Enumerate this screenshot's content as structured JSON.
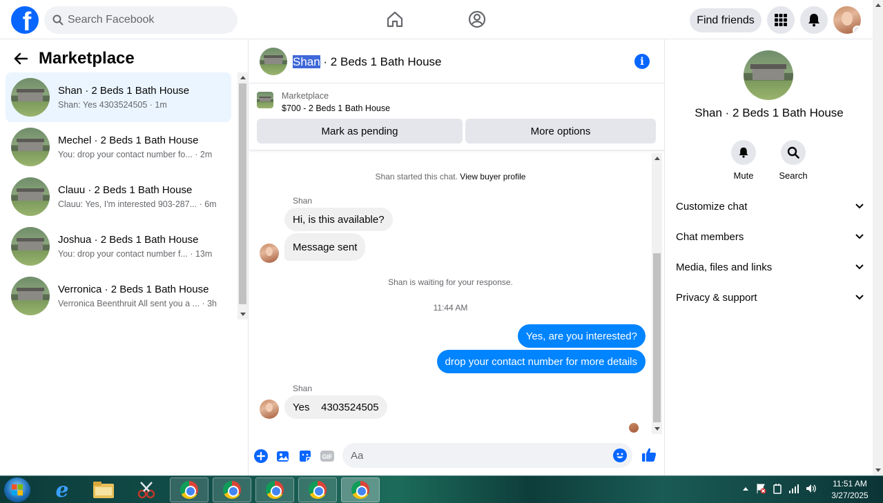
{
  "topbar": {
    "search_placeholder": "Search Facebook",
    "find_friends": "Find friends"
  },
  "left": {
    "title": "Marketplace",
    "conversations": [
      {
        "title": "Shan · 2 Beds 1 Bath House",
        "preview": "Shan: Yes 4303524505 · 1m",
        "active": true
      },
      {
        "title": "Mechel · 2 Beds 1 Bath House",
        "preview": "You: drop your contact number fo... · 2m"
      },
      {
        "title": "Clauu · 2 Beds 1 Bath House",
        "preview": "Clauu: Yes, I'm interested 903-287... · 6m"
      },
      {
        "title": "Joshua · 2 Beds 1 Bath House",
        "preview": "You: drop your contact number f... · 13m"
      },
      {
        "title": "Verronica · 2 Beds 1 Bath House",
        "preview": "Verronica Beenthruit All sent you a ... · 3h"
      }
    ]
  },
  "chat": {
    "header_name": "Shan",
    "header_rest": " · 2 Beds 1 Bath House",
    "listing_label": "Marketplace",
    "listing_price": "$700 - 2 Beds 1 Bath House",
    "mark_pending": "Mark as pending",
    "more_options": "More options",
    "started_text": "Shan started this chat.",
    "view_profile": "View buyer profile",
    "sender1": "Shan",
    "msg1": "Hi, is this available?",
    "msg2": "Message sent",
    "waiting": "Shan is waiting for your response.",
    "timestamp": "11:44 AM",
    "out1": "Yes, are you interested?",
    "out2": "drop your contact number for more details",
    "sender2": "Shan",
    "msg3": "Yes    4303524505",
    "composer_placeholder": "Aa"
  },
  "right": {
    "title": "Shan · 2 Beds 1 Bath House",
    "mute": "Mute",
    "search": "Search",
    "sections": [
      "Customize chat",
      "Chat members",
      "Media, files and links",
      "Privacy & support"
    ]
  },
  "taskbar": {
    "time": "11:51 AM",
    "date": "3/27/2025"
  },
  "colors": {
    "brand": "#0866ff",
    "outgoing_bubble": "#0084ff",
    "active_row": "#ebf5ff"
  }
}
